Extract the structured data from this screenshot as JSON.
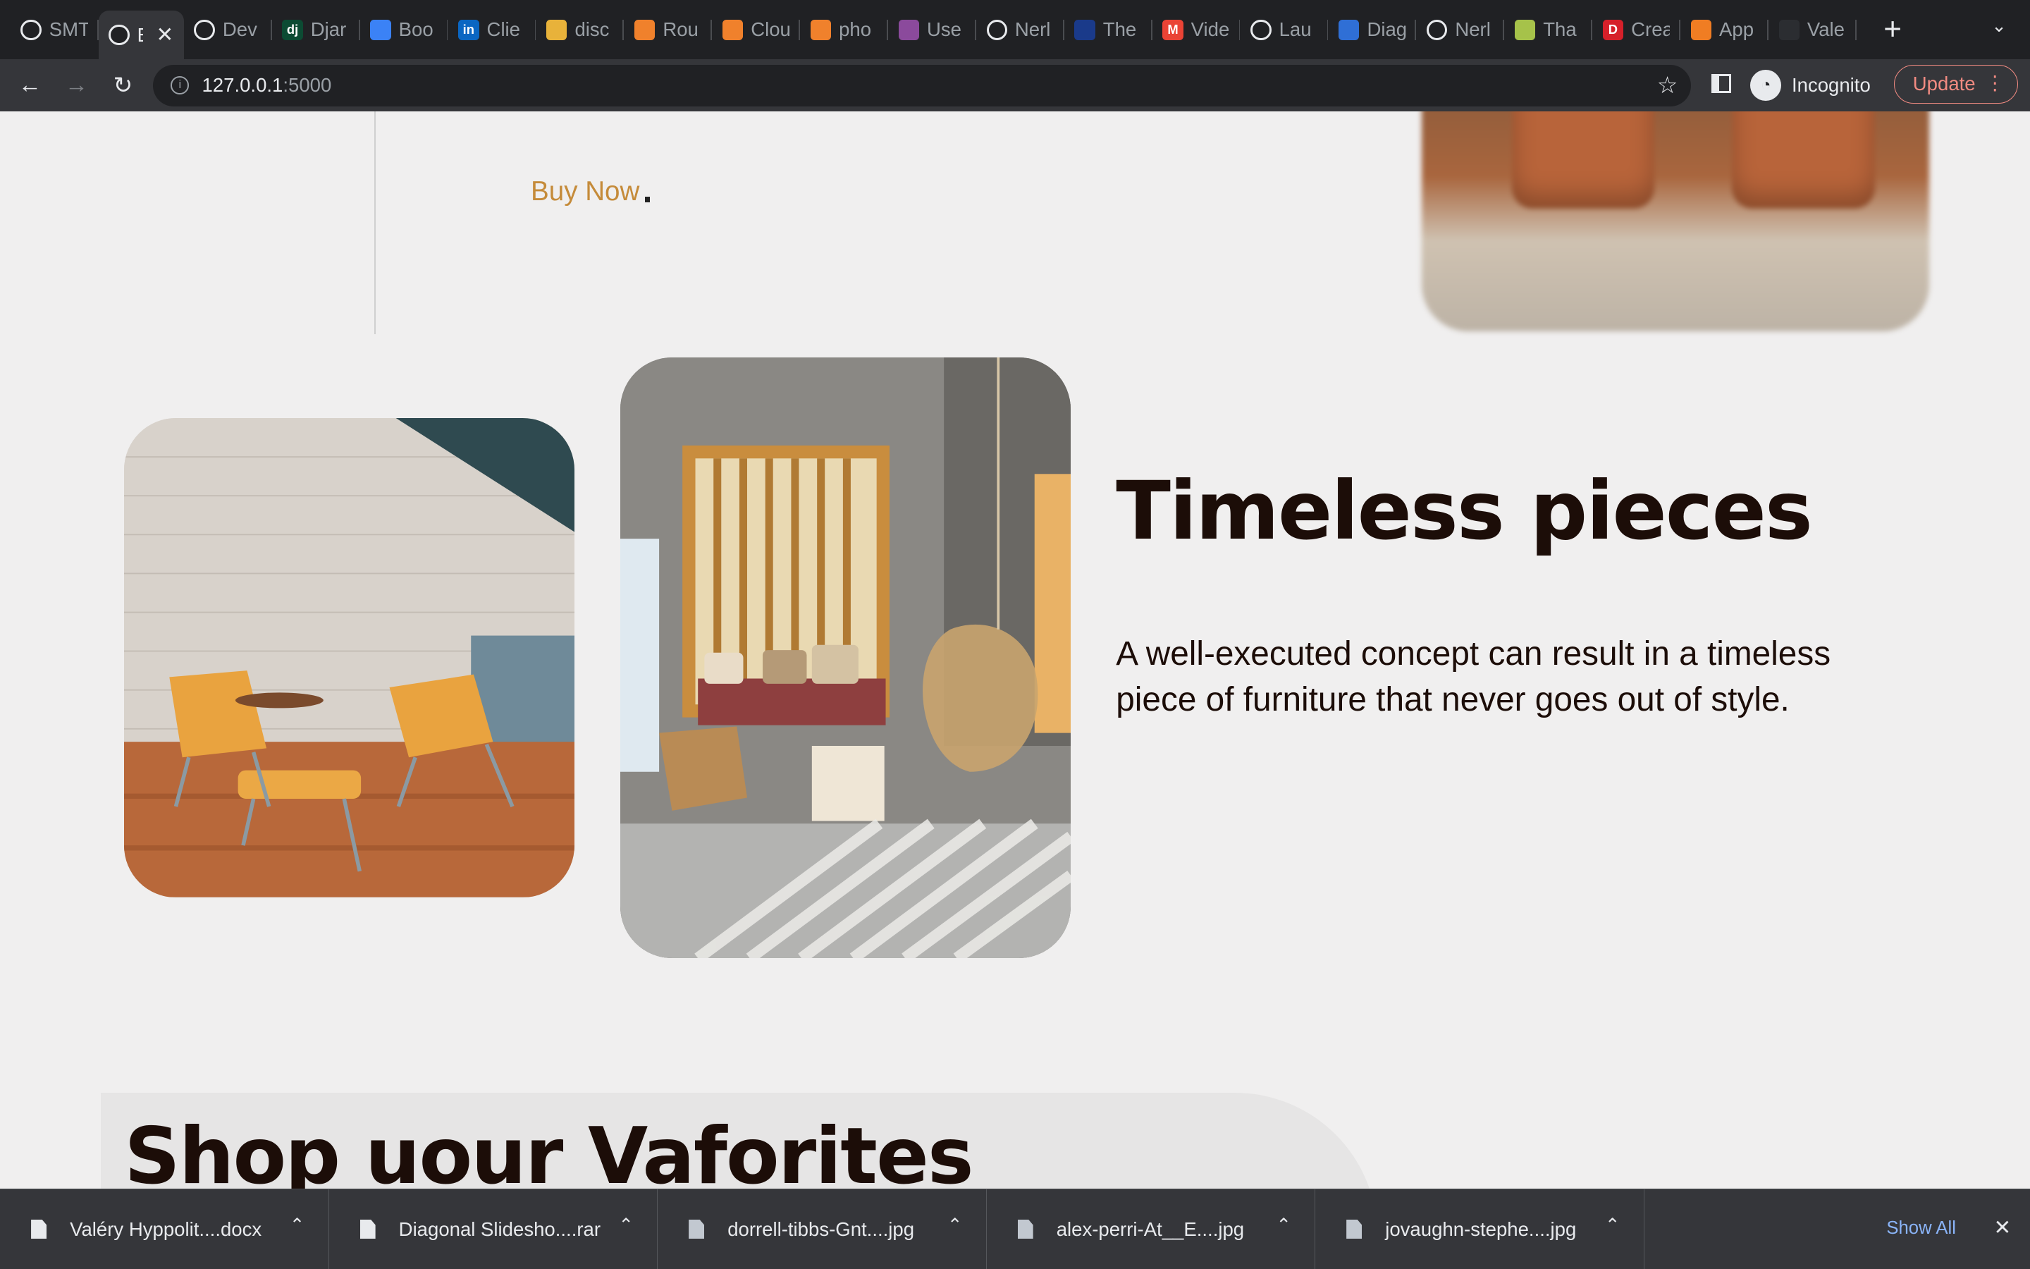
{
  "browser": {
    "tabs": [
      {
        "title": "SMT",
        "icon": "globe-icon",
        "color": "#e8eaed"
      },
      {
        "title": "E",
        "icon": "globe-icon",
        "color": "#e8eaed",
        "active": true
      },
      {
        "title": "Dev",
        "icon": "globe-icon",
        "color": "#e8eaed"
      },
      {
        "title": "Djar",
        "icon": "django-icon",
        "color": "#0c4b33",
        "glyph": "dj"
      },
      {
        "title": "Boo",
        "icon": "spinner-icon",
        "color": "#3b82f6"
      },
      {
        "title": "Clie",
        "icon": "linkedin-icon",
        "color": "#0a66c2",
        "glyph": "in"
      },
      {
        "title": "disc",
        "icon": "box-icon",
        "color": "#e8b23a"
      },
      {
        "title": "Rou",
        "icon": "cube-icon",
        "color": "#f0812c"
      },
      {
        "title": "Clou",
        "icon": "cube-icon",
        "color": "#f0812c"
      },
      {
        "title": "pho",
        "icon": "cube-icon",
        "color": "#f0812c"
      },
      {
        "title": "Use",
        "icon": "hexagon-icon",
        "color": "#8b4a9c"
      },
      {
        "title": "Nerl",
        "icon": "globe-icon",
        "color": "#e8eaed"
      },
      {
        "title": "The",
        "icon": "wave-icon",
        "color": "#1a3a8a"
      },
      {
        "title": "Vide",
        "icon": "gmail-icon",
        "color": "#ea4335",
        "glyph": "M"
      },
      {
        "title": "Lau",
        "icon": "globe-icon",
        "color": "#e8eaed"
      },
      {
        "title": "Diag",
        "icon": "diagram-icon",
        "color": "#2f6fd6"
      },
      {
        "title": "Nerl",
        "icon": "globe-icon",
        "color": "#e8eaed"
      },
      {
        "title": "Tha",
        "icon": "pill-icon",
        "color": "#a6c24a"
      },
      {
        "title": "Crea",
        "icon": "d-icon",
        "color": "#d6202a",
        "glyph": "D"
      },
      {
        "title": "App",
        "icon": "circle-icon",
        "color": "#f07d23"
      },
      {
        "title": "Vale",
        "icon": "github-icon",
        "color": "#2b2d31"
      }
    ],
    "new_tab": "+",
    "url_host": "127.0.0.1",
    "url_port": ":5000",
    "incognito_label": "Incognito",
    "update_label": "Update"
  },
  "page": {
    "buy_now": "Buy Now",
    "heading": "Timeless pieces",
    "paragraph": "A well-executed concept can result in a timeless piece of furniture that never goes out of style.",
    "favorites_title": "Shop uour Vaforites"
  },
  "downloads": {
    "items": [
      {
        "name": "Valéry Hyppolit....docx",
        "type": "doc"
      },
      {
        "name": "Diagonal Slidesho....rar",
        "type": "doc"
      },
      {
        "name": "dorrell-tibbs-Gnt....jpg",
        "type": "img"
      },
      {
        "name": "alex-perri-At__E....jpg",
        "type": "img"
      },
      {
        "name": "jovaughn-stephe....jpg",
        "type": "img"
      }
    ],
    "show_all": "Show All"
  },
  "colors": {
    "accent": "#c58b3a",
    "heading": "#1c0d08",
    "page_bg": "#f0efef",
    "update": "#f28b82"
  }
}
